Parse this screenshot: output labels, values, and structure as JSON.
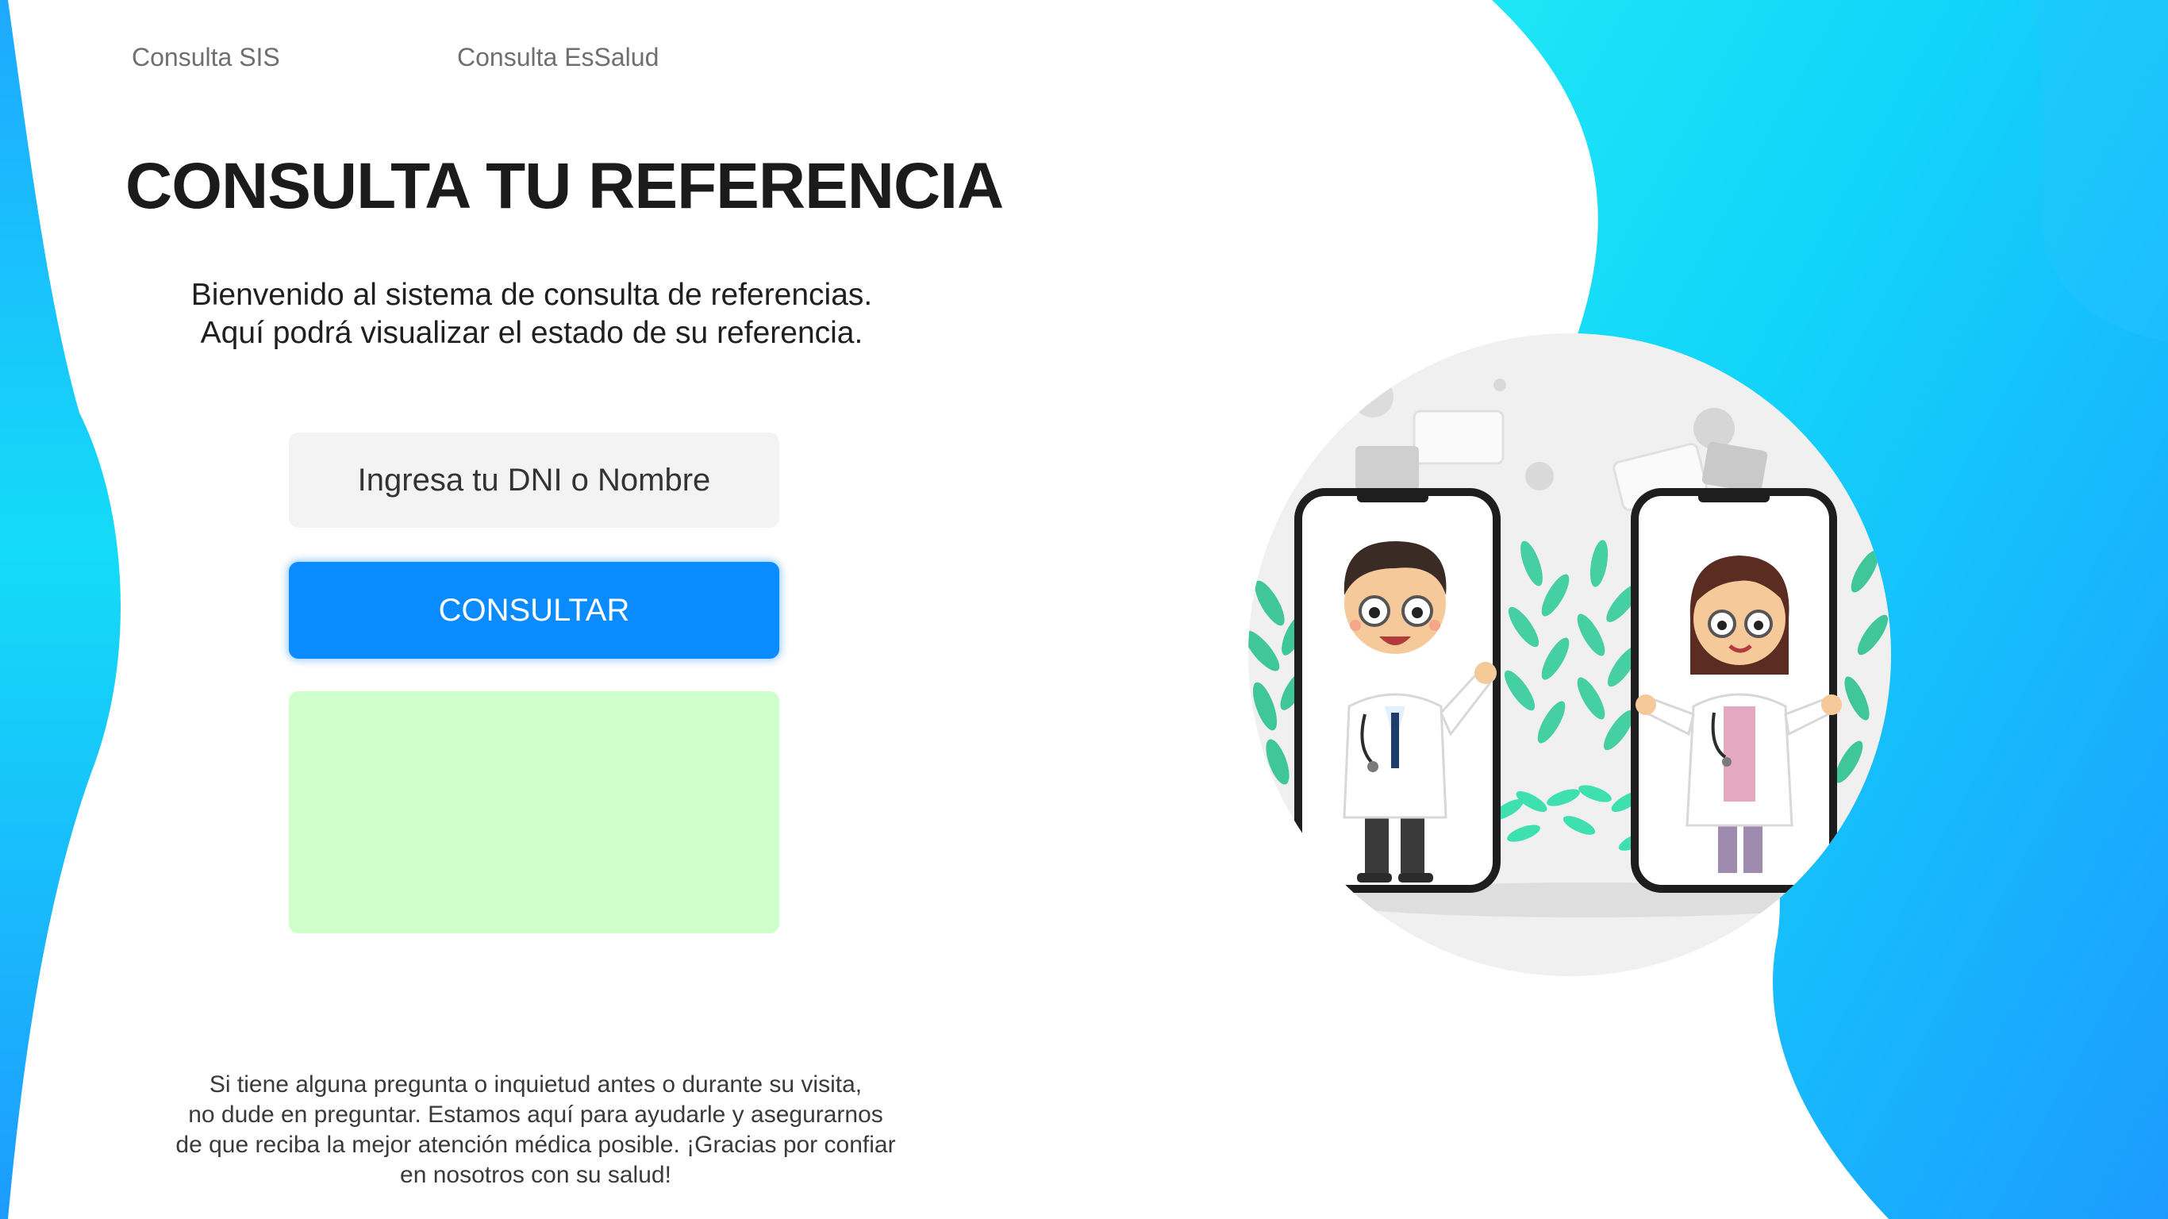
{
  "nav": {
    "sis_label": "Consulta SIS",
    "essalud_label": "Consulta EsSalud"
  },
  "main": {
    "title": "CONSULTA TU REFERENCIA",
    "welcome_line1": "Bienvenido al sistema de consulta de referencias.",
    "welcome_line2": "Aquí podrá visualizar el estado de su referencia.",
    "search_placeholder": "Ingresa tu DNI o Nombre",
    "search_value": "",
    "button_label": "CONSULTAR"
  },
  "footer": {
    "line1": "Si tiene alguna pregunta o inquietud antes o durante su visita,",
    "line2": "no dude en preguntar. Estamos aquí para ayudarle y asegurarnos",
    "line3": "de que reciba la mejor atención médica posible. ¡Gracias por confiar",
    "line4": "en nosotros con su salud!"
  },
  "colors": {
    "accent_blue": "#0a8bff",
    "cyan": "#14d8f8",
    "result_green": "#cfffca",
    "input_gray": "#f3f3f3"
  },
  "icons": {
    "illustration": "doctors-video-call-illustration"
  }
}
